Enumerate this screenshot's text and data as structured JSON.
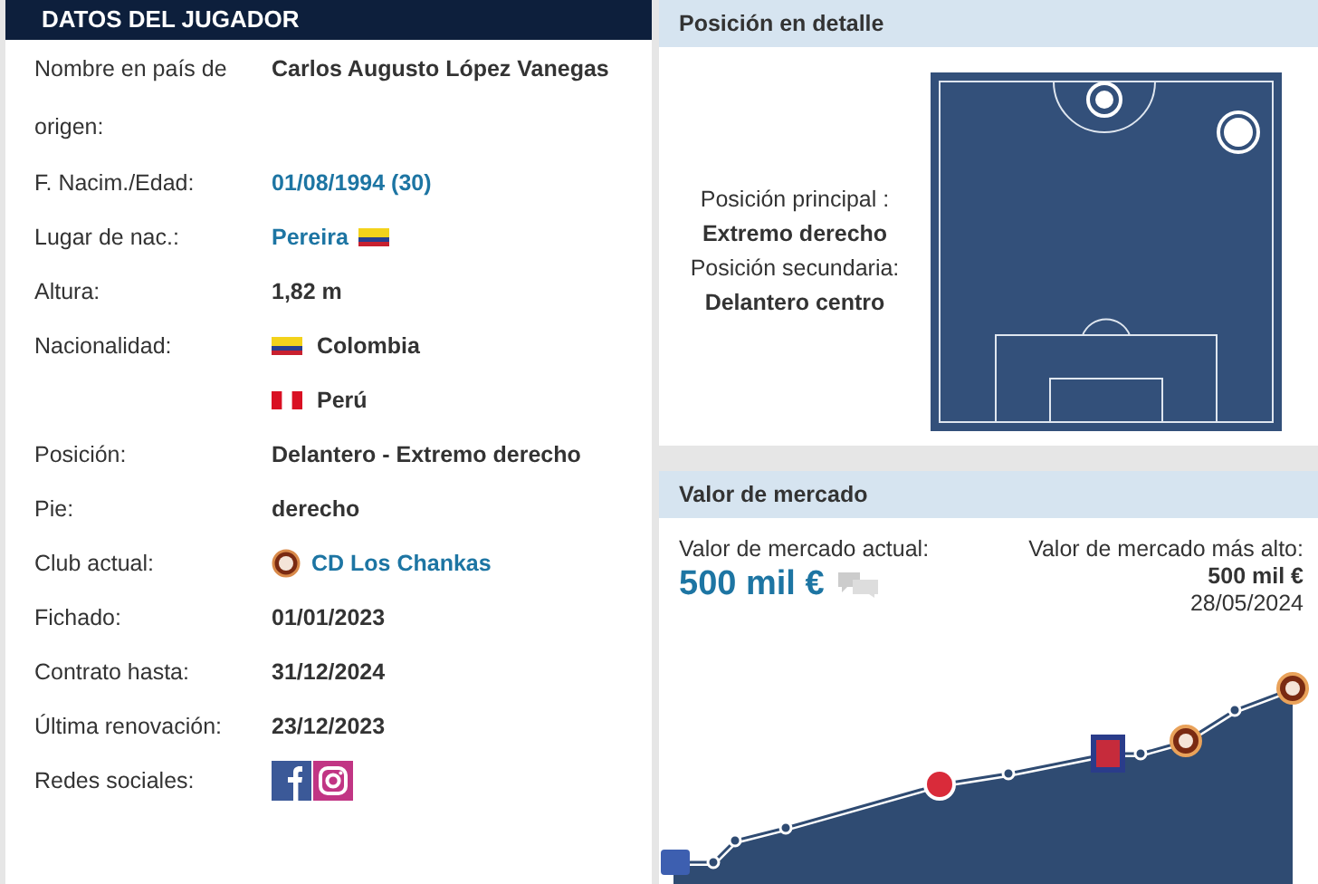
{
  "player_data": {
    "title": "DATOS DEL JUGADOR",
    "facts": [
      {
        "kind": "text",
        "label": "Nombre en país de origen:",
        "value": "Carlos Augusto López Vanegas"
      },
      {
        "kind": "link",
        "label": "F. Nacim./Edad:",
        "value": "01/08/1994 (30)"
      },
      {
        "kind": "link-flag",
        "label": "Lugar de nac.:",
        "value": "Pereira"
      },
      {
        "kind": "text",
        "label": "Altura:",
        "value": "1,82 m"
      },
      {
        "kind": "nationalities",
        "label": "Nacionalidad:",
        "values": [
          "Colombia",
          "Perú"
        ]
      },
      {
        "kind": "text",
        "label": "Posición:",
        "value": "Delantero - Extremo derecho"
      },
      {
        "kind": "text",
        "label": "Pie:",
        "value": "derecho"
      },
      {
        "kind": "club",
        "label": "Club actual:",
        "value": "CD Los Chankas"
      },
      {
        "kind": "text",
        "label": "Fichado:",
        "value": "01/01/2023"
      },
      {
        "kind": "text",
        "label": "Contrato hasta:",
        "value": "31/12/2024"
      },
      {
        "kind": "text",
        "label": "Última renovación:",
        "value": "23/12/2023"
      },
      {
        "kind": "social",
        "label": "Redes sociales:"
      }
    ]
  },
  "position_detail": {
    "title": "Posición en detalle",
    "primary_label": "Posición principal :",
    "primary": "Extremo derecho",
    "secondary_label": "Posición secundaria:",
    "secondary": "Delantero centro"
  },
  "market_value": {
    "title": "Valor de mercado",
    "current_label": "Valor de mercado actual:",
    "current_value": "500 mil €",
    "highest_label": "Valor de mercado más alto:",
    "highest_value": "500 mil €",
    "highest_date": "28/05/2024"
  }
}
